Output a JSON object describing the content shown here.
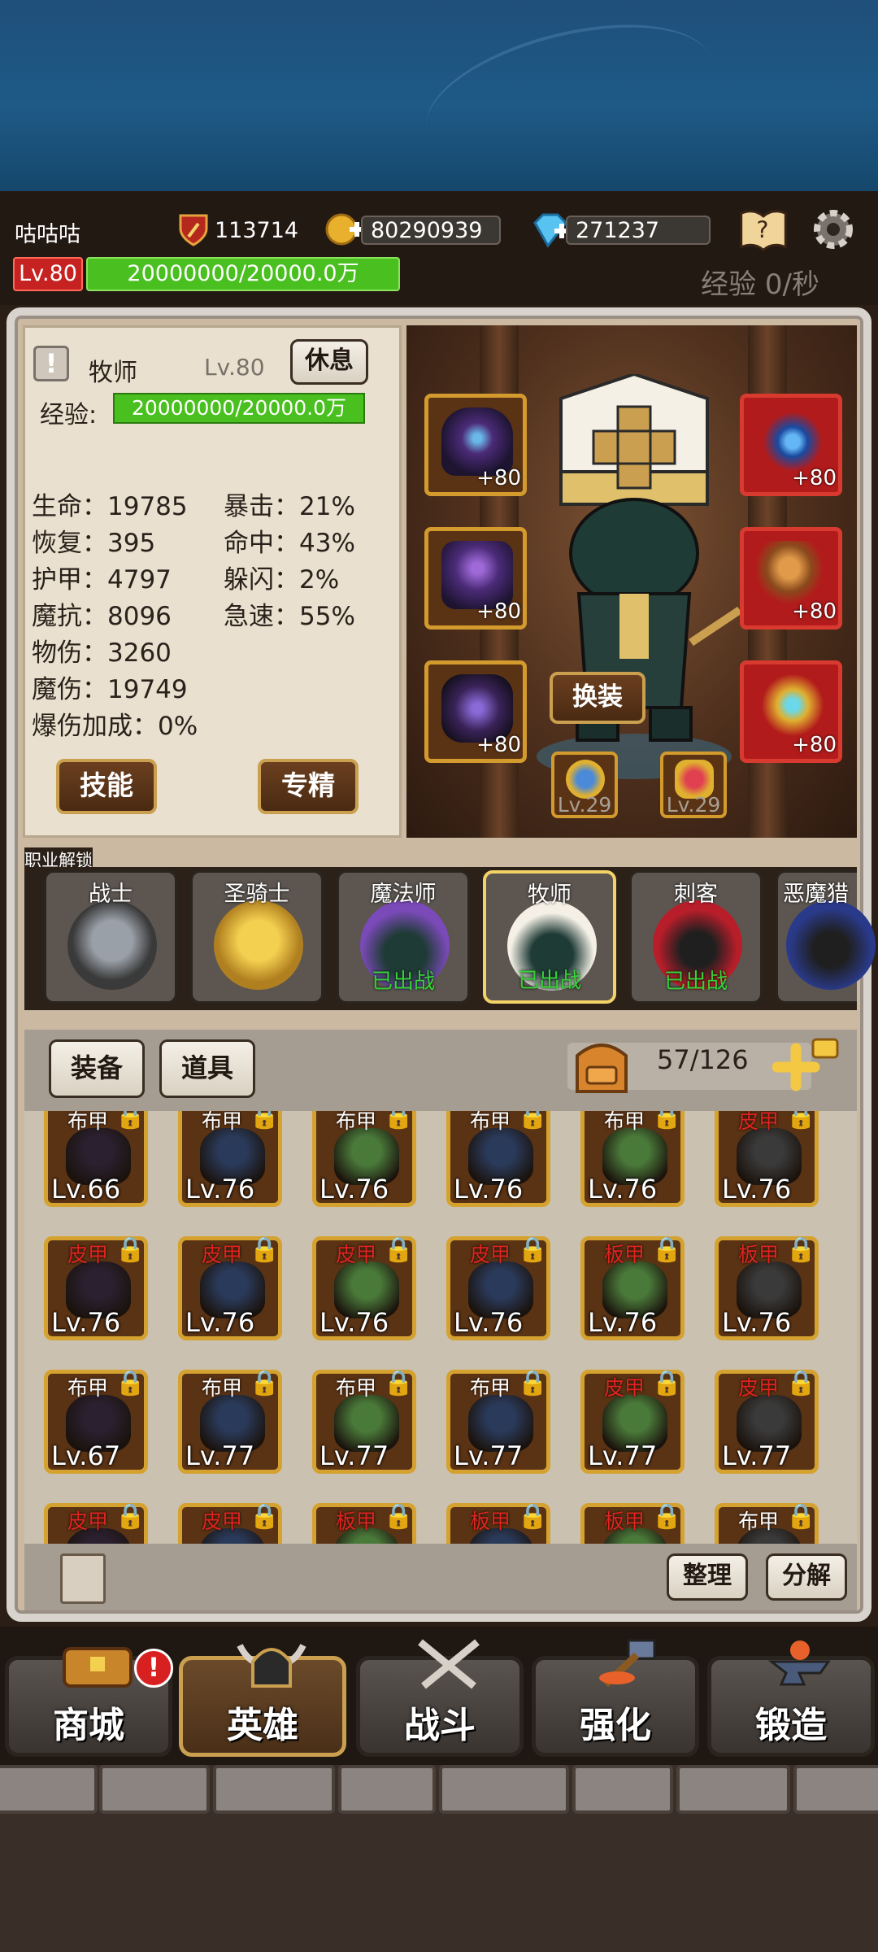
{
  "player": {
    "name": "咕咕咕",
    "power": "113714",
    "gold": "80290939",
    "gems": "271237",
    "level": "Lv.80",
    "xp": "20000000/20000.0万",
    "xp_rate": "经验 0/秒"
  },
  "hero": {
    "class_name": "牧师",
    "level": "Lv.80",
    "rest_label": "休息",
    "xp_label": "经验:",
    "xp_value": "20000000/20000.0万",
    "stats_left": [
      "生命：19785",
      "恢复：395",
      "护甲：4797",
      "魔抗：8096",
      "物伤：3260",
      "魔伤：19749",
      "爆伤加成：0%"
    ],
    "stats_right": [
      "暴击：21%",
      "命中：43%",
      "躲闪：2%",
      "急速：55%"
    ],
    "skill_label": "技能",
    "spec_label": "专精",
    "change_outfit_label": "换装",
    "equip_left": [
      "+80",
      "+80",
      "+80"
    ],
    "equip_right": [
      "+80",
      "+80",
      "+80"
    ],
    "badges": [
      "Lv.29",
      "Lv.29"
    ]
  },
  "class_unlock": {
    "title": "职业解锁",
    "classes": [
      {
        "name": "战士",
        "status": ""
      },
      {
        "name": "圣骑士",
        "status": ""
      },
      {
        "name": "魔法师",
        "status": "已出战"
      },
      {
        "name": "牧师",
        "status": "已出战"
      },
      {
        "name": "刺客",
        "status": "已出战"
      },
      {
        "name": "恶魔猎",
        "status": ""
      }
    ]
  },
  "inventory": {
    "tab_equip": "装备",
    "tab_items": "道具",
    "capacity": "57/126",
    "sort_label": "整理",
    "decompose_label": "分解",
    "items": [
      {
        "type": "布甲",
        "lv": "Lv.66",
        "red": false
      },
      {
        "type": "布甲",
        "lv": "Lv.76",
        "red": false
      },
      {
        "type": "布甲",
        "lv": "Lv.76",
        "red": false
      },
      {
        "type": "布甲",
        "lv": "Lv.76",
        "red": false
      },
      {
        "type": "布甲",
        "lv": "Lv.76",
        "red": false
      },
      {
        "type": "皮甲",
        "lv": "Lv.76",
        "red": true
      },
      {
        "type": "皮甲",
        "lv": "Lv.76",
        "red": true
      },
      {
        "type": "皮甲",
        "lv": "Lv.76",
        "red": true
      },
      {
        "type": "皮甲",
        "lv": "Lv.76",
        "red": true
      },
      {
        "type": "皮甲",
        "lv": "Lv.76",
        "red": true
      },
      {
        "type": "板甲",
        "lv": "Lv.76",
        "red": true
      },
      {
        "type": "板甲",
        "lv": "Lv.76",
        "red": true
      },
      {
        "type": "布甲",
        "lv": "Lv.67",
        "red": false
      },
      {
        "type": "布甲",
        "lv": "Lv.77",
        "red": false
      },
      {
        "type": "布甲",
        "lv": "Lv.77",
        "red": false
      },
      {
        "type": "布甲",
        "lv": "Lv.77",
        "red": false
      },
      {
        "type": "皮甲",
        "lv": "Lv.77",
        "red": true
      },
      {
        "type": "皮甲",
        "lv": "Lv.77",
        "red": true
      },
      {
        "type": "皮甲",
        "lv": "",
        "red": true
      },
      {
        "type": "皮甲",
        "lv": "",
        "red": true
      },
      {
        "type": "板甲",
        "lv": "",
        "red": true
      },
      {
        "type": "板甲",
        "lv": "",
        "red": true
      },
      {
        "type": "板甲",
        "lv": "",
        "red": true
      },
      {
        "type": "布甲",
        "lv": "",
        "red": false
      }
    ]
  },
  "nav": [
    "商城",
    "英雄",
    "战斗",
    "强化",
    "锻造"
  ],
  "colors": {
    "accent_gold": "#d5a230",
    "xp_green": "#49c01f",
    "deployed_green": "#35d336",
    "level_red": "#c72222"
  }
}
